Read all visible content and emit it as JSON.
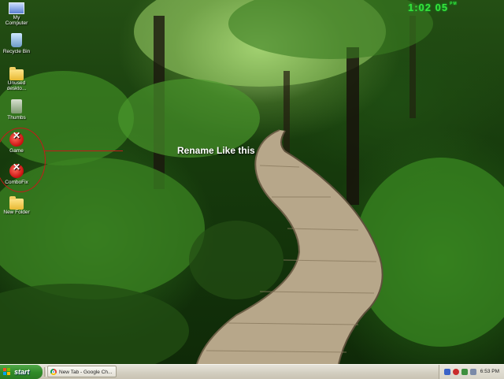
{
  "desktop": {
    "icons": [
      {
        "label": "My Computer",
        "icon": "my-computer-icon"
      },
      {
        "label": "Recycle Bin",
        "icon": "recycle-bin-icon"
      },
      {
        "label": "Unused deskto...",
        "icon": "folder-icon"
      },
      {
        "label": "Thumbs",
        "icon": "thumbs-file-icon"
      },
      {
        "label": "Game",
        "icon": "combofix-icon"
      },
      {
        "label": "ComboFix",
        "icon": "combofix-icon"
      },
      {
        "label": "New Folder",
        "icon": "folder-icon"
      }
    ],
    "annotation_text": "Rename Like this",
    "annotation_color": "#c41a1a"
  },
  "gadget": {
    "time": "1:02",
    "seconds": "05",
    "suffix": "PM",
    "color": "#38e23a"
  },
  "taskbar": {
    "start_label": "start",
    "tasks": [
      {
        "label": "New Tab - Google Ch...",
        "icon": "chrome-icon"
      }
    ],
    "tray_time": "6:53 PM"
  }
}
